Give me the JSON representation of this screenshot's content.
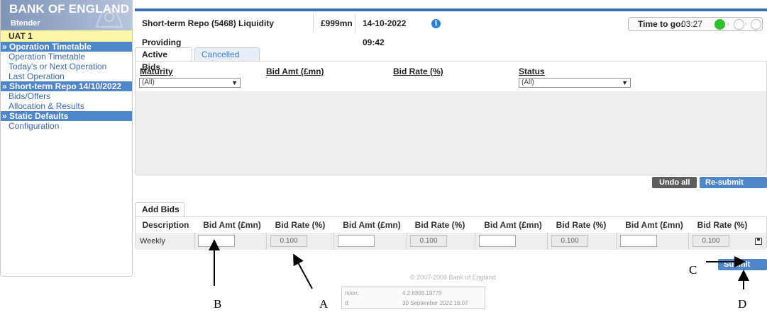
{
  "sidebar": {
    "logo": "BANK OF ENGLAND",
    "app_name": "Btender",
    "environment": "UAT 1",
    "sections": [
      {
        "title": "» Operation Timetable",
        "items": [
          "Operation Timetable",
          "Today's or Next Operation",
          "Last Operation"
        ]
      },
      {
        "title": "» Short-term Repo 14/10/2022",
        "items": [
          "Bids/Offers",
          "Allocation & Results"
        ]
      },
      {
        "title": "» Static Defaults",
        "items": [
          "Configuration"
        ]
      }
    ]
  },
  "header": {
    "operation": "Short-term Repo (5468) Liquidity Providing",
    "amount": "£999mn",
    "datetime": "14-10-2022 09:42",
    "info_icon": "info-icon",
    "time_to_go_label": "Time to go:",
    "time_to_go_value": "03:27"
  },
  "bids": {
    "tabs": [
      "Active Bids",
      "Cancelled Bids"
    ],
    "columns": [
      "Maturity",
      "Bid Amt (£mn)",
      "Bid Rate (%)",
      "Status"
    ],
    "maturity_filter": "(All)",
    "status_filter": "(All)",
    "undo_all": "Undo all",
    "resubmit_all": "Re-submit all"
  },
  "add_bids": {
    "tab": "Add Bids",
    "columns": [
      "Description",
      "Bid Amt (£mn)",
      "Bid Rate (%)",
      "Bid Amt (£mn)",
      "Bid Rate (%)",
      "Bid Amt (£mn)",
      "Bid Rate (%)",
      "Bid Amt (£mn)",
      "Bid Rate (%)"
    ],
    "row_description": "Weekly",
    "rate_placeholder": "0.100",
    "submit_all": "Submit All",
    "save_icon": "save-icon"
  },
  "footer": {
    "copyright": "© 2007-2008 Bank of England",
    "version_label": "rsion:",
    "version_value": "4.2.8308.19775",
    "built_label": "d:",
    "built_value": "30 September 2022 16:07"
  },
  "annotations": {
    "a": "A",
    "b": "B",
    "c": "C",
    "d": "D"
  },
  "colors": {
    "nav_blue": "#4f86c8",
    "uat_yellow": "#fdf6a6",
    "timer_green": "#2fc02f",
    "button_dark": "#5d5d5d"
  }
}
